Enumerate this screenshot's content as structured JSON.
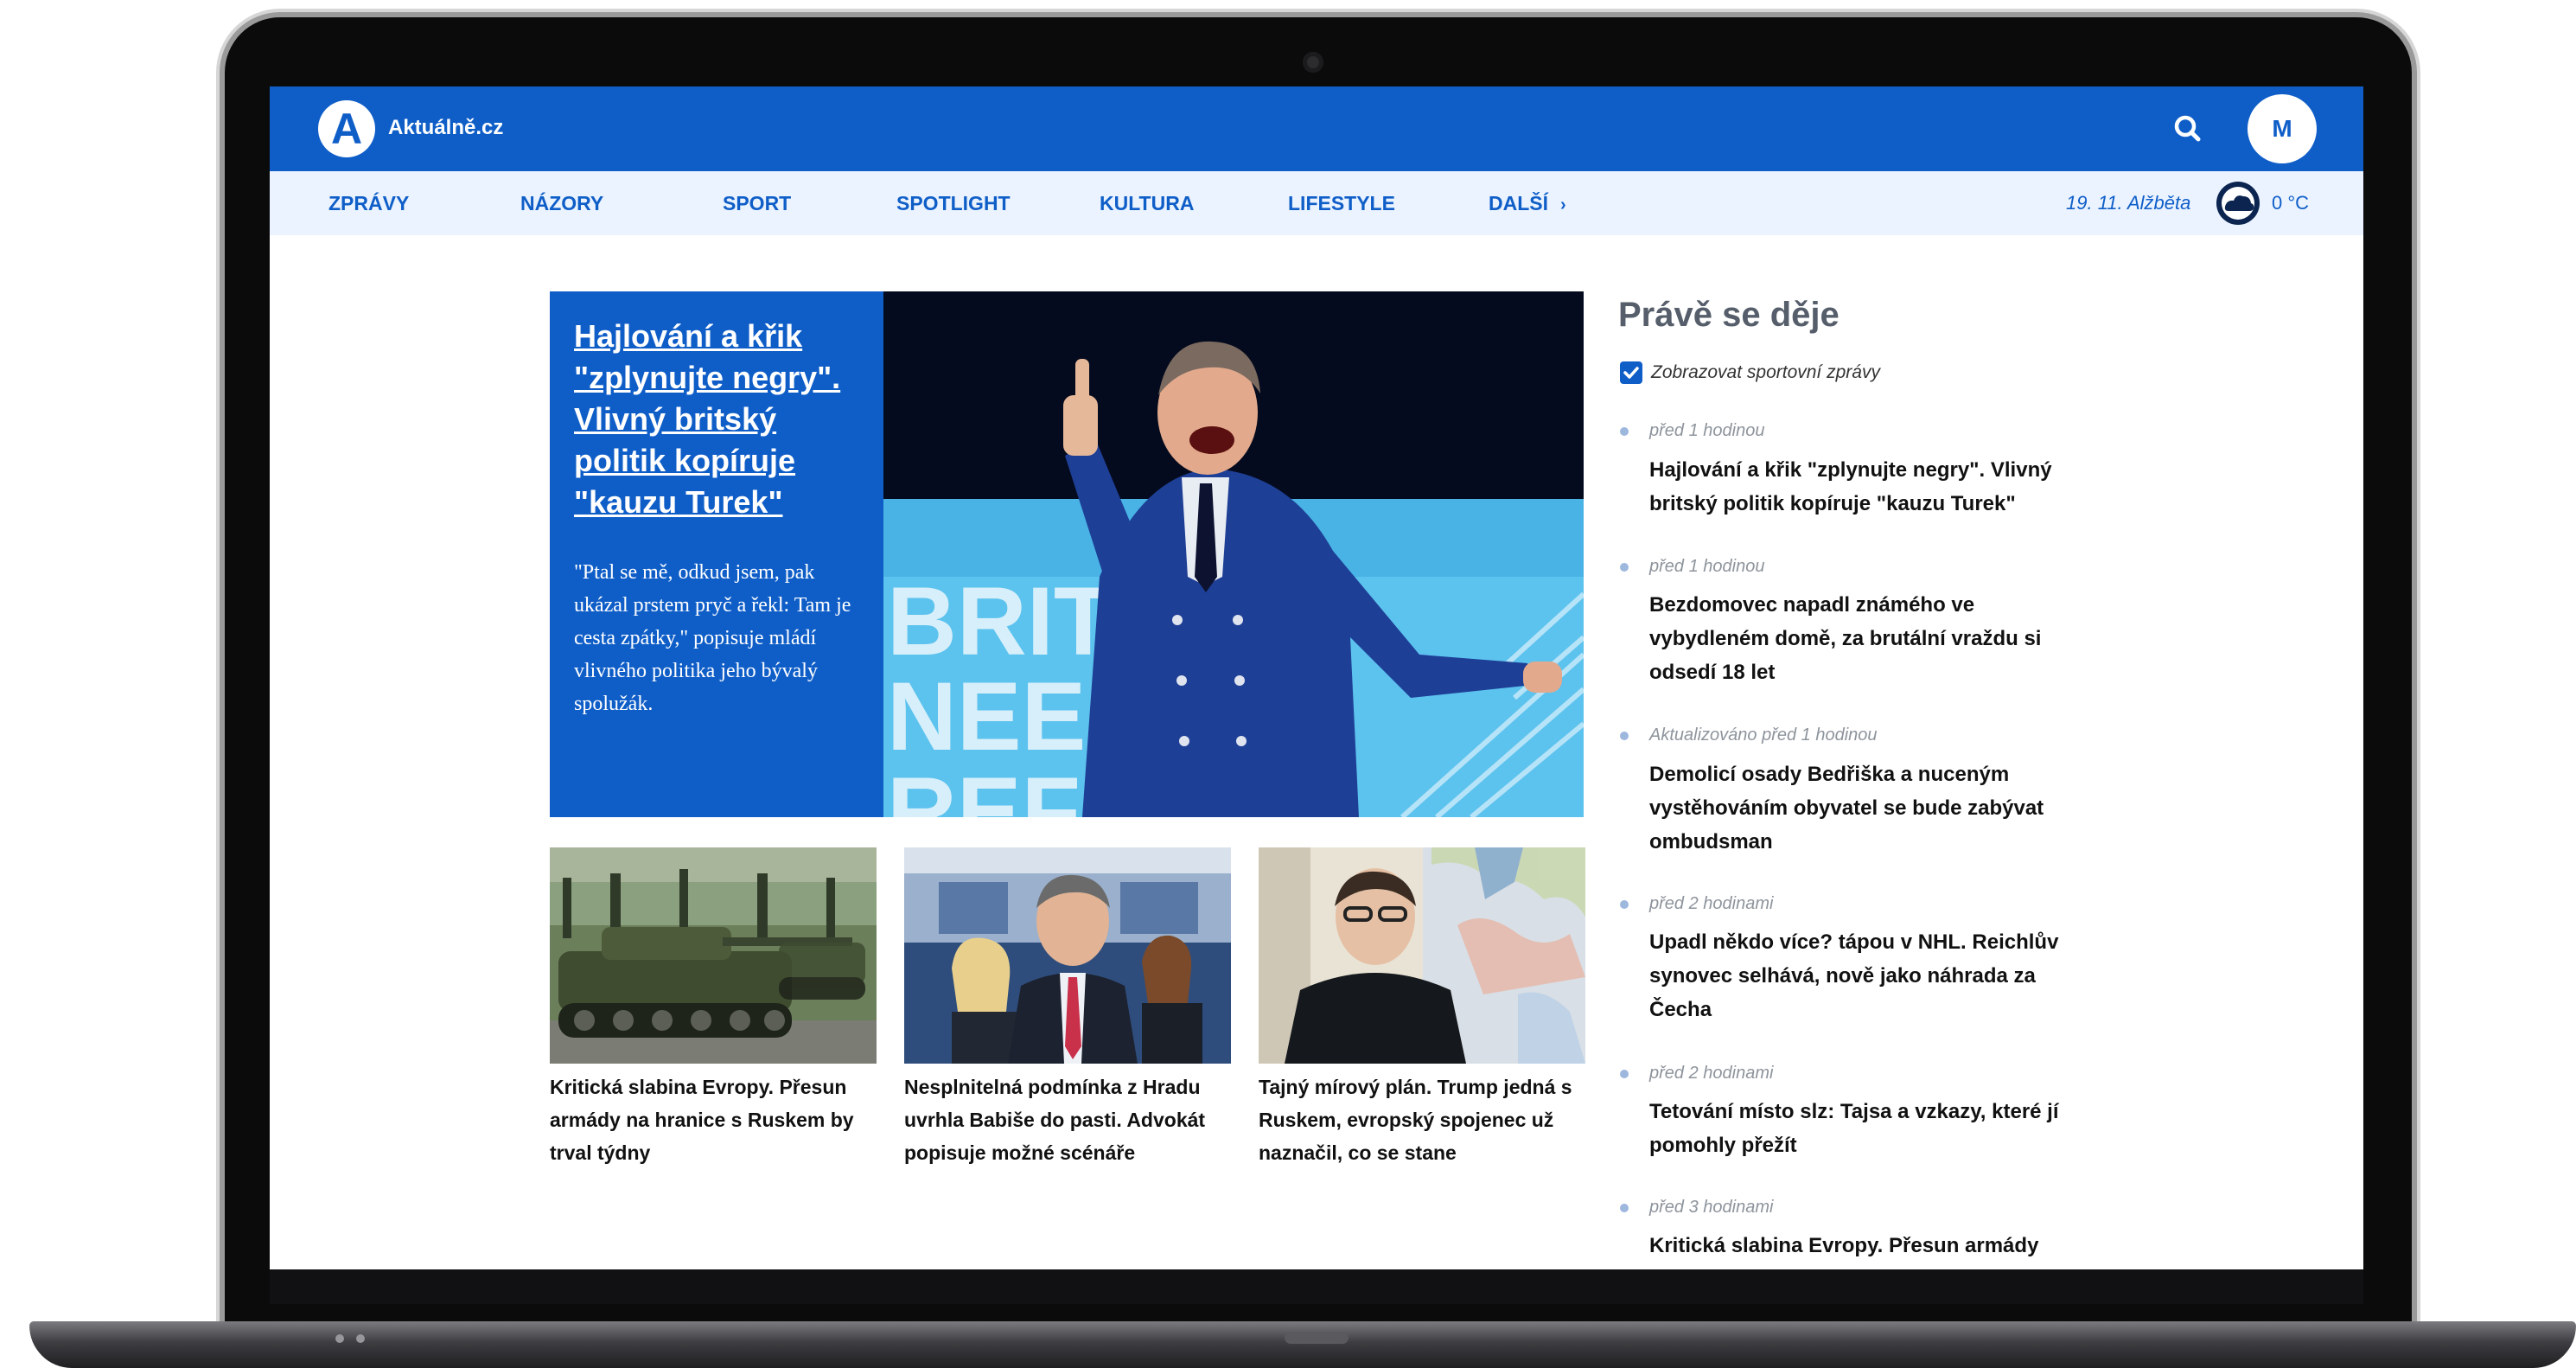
{
  "site": {
    "logo_letter": "A",
    "logo_text": "Aktuálně.cz",
    "avatar_initial": "M"
  },
  "nav": {
    "items": [
      "ZPRÁVY",
      "NÁZORY",
      "SPORT",
      "SPOTLIGHT",
      "KULTURA",
      "LIFESTYLE"
    ],
    "more_label": "DALŠÍ",
    "more_icon": "chevron-right-icon",
    "date": "19. 11. Alžběta",
    "weather_icon": "cloudy-weather-icon",
    "temperature": "0 °C"
  },
  "hero": {
    "title": "Hajlování a křik \"zplynujte negry\". Vlivný britský politik kopíruje \"kauzu Turek\"",
    "perex": "\"Ptal se mě, odkud jsem, pak ukázal prstem pryč a řekl: Tam je cesta zpátky,\" popisuje mládí vlivného politika jeho bývalý spolužák.",
    "photo_sign": "BRIT NEED REF"
  },
  "cards": [
    {
      "title": "Kritická slabina Evropy. Přesun armády na hranice s Ruskem by trval týdny"
    },
    {
      "title": "Nesplnitelná podmínka z Hradu uvrhla Babiše do pasti. Advokát popisuje možné scénáře"
    },
    {
      "title": "Tajný mírový plán. Trump jedná s Ruskem, evropský spojenec už naznačil, co se stane"
    }
  ],
  "feed": {
    "heading": "Právě se děje",
    "checkbox_label": "Zobrazovat sportovní zprávy",
    "checkbox_checked": true,
    "items": [
      {
        "time": "před 1 hodinou",
        "title": "Hajlování a křik \"zplynujte negry\". Vlivný britský politik kopíruje \"kauzu Turek\""
      },
      {
        "time": "před 1 hodinou",
        "title": "Bezdomovec napadl známého ve vybydleném domě, za brutální vraždu si odsedí 18 let"
      },
      {
        "time": "Aktualizováno před 1 hodinou",
        "title": "Demolicí osady Bedřiška a nuceným vystěhováním obyvatel se bude zabývat ombudsman"
      },
      {
        "time": "před 2 hodinami",
        "title": "Upadl někdo více? tápou v NHL. Reichlův synovec selhává, nově jako náhrada za Čecha"
      },
      {
        "time": "před 2 hodinami",
        "title": "Tetování místo slz: Tajsa a vzkazy, které jí pomohly přežít"
      },
      {
        "time": "před 3 hodinami",
        "title": "Kritická slabina Evropy. Přesun armády"
      }
    ]
  },
  "colors": {
    "brand_blue": "#0f5ec8",
    "nav_background": "#eaf3ff"
  }
}
